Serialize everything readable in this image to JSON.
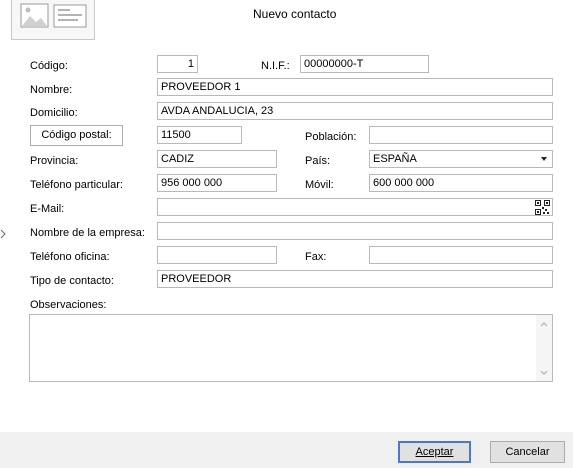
{
  "window": {
    "title": "Nuevo contacto"
  },
  "form": {
    "codigo": {
      "label": "Código:",
      "value": "1"
    },
    "nif": {
      "label": "N.I.F.:",
      "value": "00000000-T"
    },
    "nombre": {
      "label": "Nombre:",
      "value": "PROVEEDOR 1"
    },
    "domicilio": {
      "label": "Domicilio:",
      "value": "AVDA ANDALUCIA, 23"
    },
    "codigo_postal": {
      "button_label": "Código postal:",
      "value": "11500"
    },
    "poblacion": {
      "label": "Población:",
      "value": ""
    },
    "provincia": {
      "label": "Provincia:",
      "value": "CADIZ"
    },
    "pais": {
      "label": "País:",
      "value": "ESPAÑA"
    },
    "telefono_particular": {
      "label": "Teléfono particular:",
      "value": "956 000 000"
    },
    "movil": {
      "label": "Móvil:",
      "value": "600 000 000"
    },
    "email": {
      "label": "E-Mail:",
      "value": ""
    },
    "nombre_empresa": {
      "label": "Nombre de la empresa:",
      "value": ""
    },
    "telefono_oficina": {
      "label": "Teléfono oficina:",
      "value": ""
    },
    "fax": {
      "label": "Fax:",
      "value": ""
    },
    "tipo_contacto": {
      "label": "Tipo de contacto:",
      "value": "PROVEEDOR"
    },
    "observaciones": {
      "label": "Observaciones:",
      "value": ""
    }
  },
  "buttons": {
    "accept": "Aceptar",
    "cancel": "Cancelar"
  },
  "icons": {
    "header": "contact-card-icon",
    "email": "qr-code-icon",
    "dropdown": "chevron-down-icon",
    "row_marker": "chevron-right-icon"
  },
  "colors": {
    "footer_bg": "#f0f0f0",
    "default_button_border": "#4b78c9",
    "field_border": "#b9b9b9"
  }
}
